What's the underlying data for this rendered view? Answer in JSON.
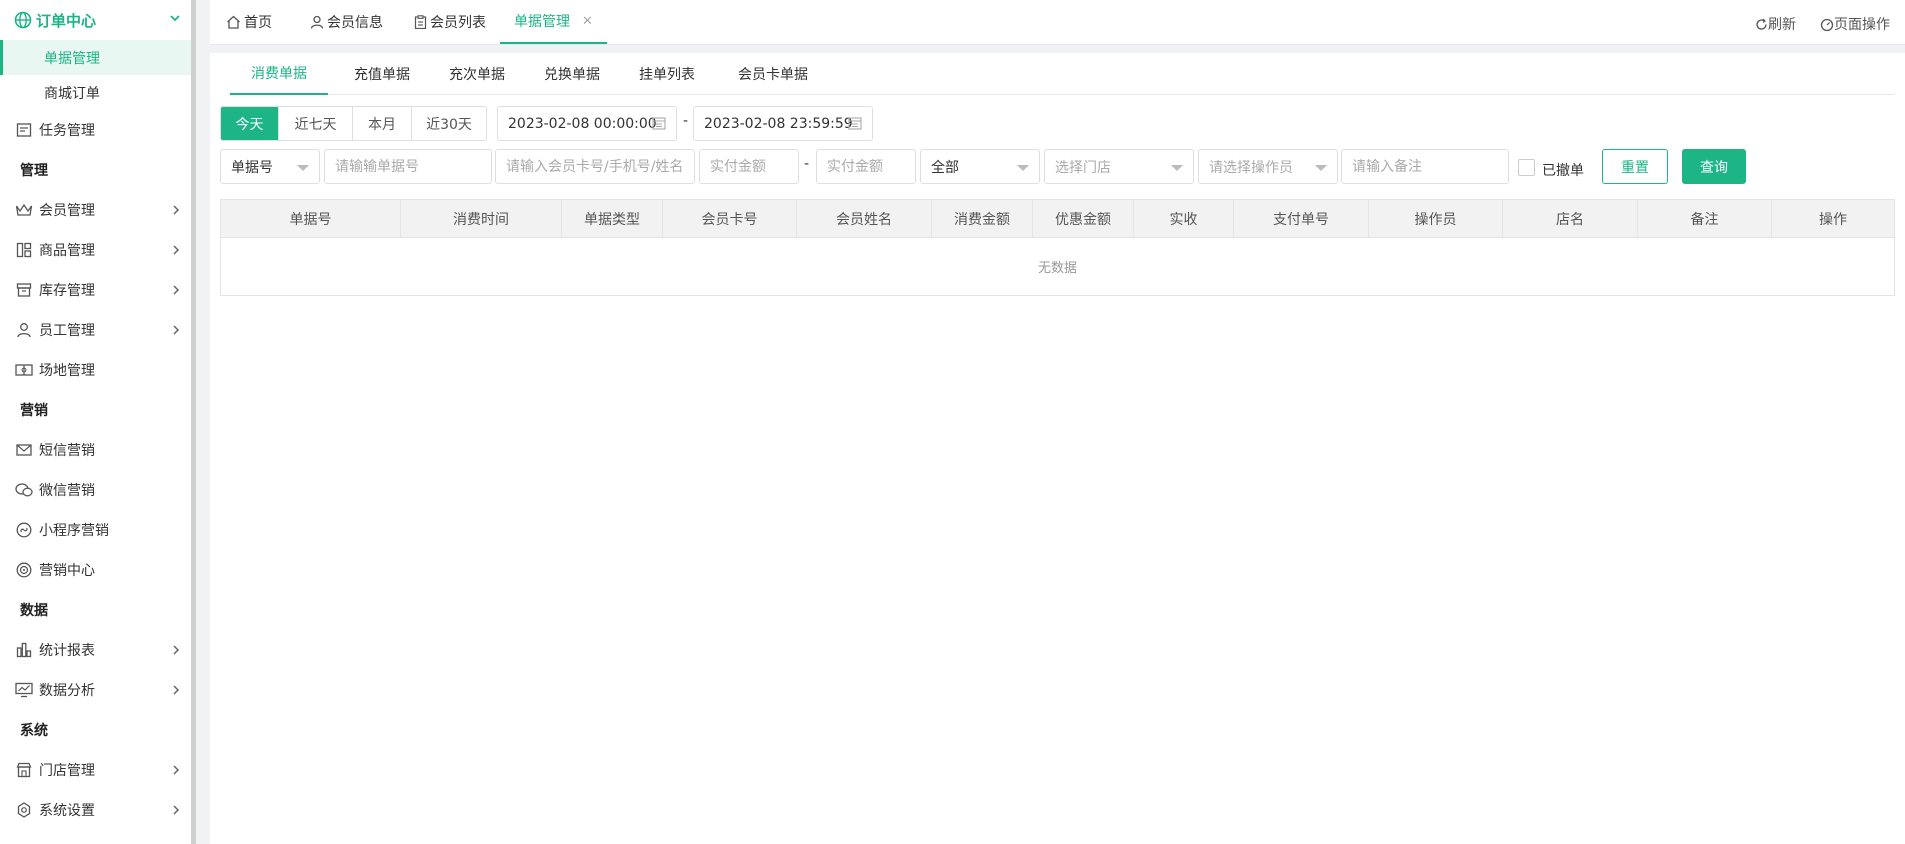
{
  "sidebar": {
    "open_group": "订单中心",
    "sub_items": [
      {
        "label": "单据管理",
        "active": true
      },
      {
        "label": "商城订单",
        "active": false
      }
    ],
    "task_item": "任务管理",
    "sections": [
      {
        "title": "管理",
        "items": [
          "会员管理",
          "商品管理",
          "库存管理",
          "员工管理",
          "场地管理"
        ]
      },
      {
        "title": "营销",
        "items": [
          "短信营销",
          "微信营销",
          "小程序营销",
          "营销中心"
        ]
      },
      {
        "title": "数据",
        "items": [
          "统计报表",
          "数据分析"
        ]
      },
      {
        "title": "系统",
        "items": [
          "门店管理",
          "系统设置"
        ]
      }
    ]
  },
  "top_tabs": [
    {
      "label": "首页",
      "icon": "home-icon"
    },
    {
      "label": "会员信息",
      "icon": "user-icon"
    },
    {
      "label": "会员列表",
      "icon": "clipboard-icon"
    },
    {
      "label": "单据管理",
      "icon": "",
      "active": true,
      "closable": true
    }
  ],
  "top_actions": {
    "refresh": "刷新",
    "page_ops": "页面操作"
  },
  "sub_tabs": [
    "消费单据",
    "充值单据",
    "充次单据",
    "兑换单据",
    "挂单列表",
    "会员卡单据"
  ],
  "date_range_buttons": [
    "今天",
    "近七天",
    "本月",
    "近30天"
  ],
  "date_start": "2023-02-08 00:00:00",
  "date_end": "2023-02-08 23:59:59",
  "date_separator": "-",
  "filters": {
    "order_type_select": "单据号",
    "order_no_placeholder": "请输输单据号",
    "member_placeholder": "请输入会员卡号/手机号/姓名",
    "amount_min_placeholder": "实付金额",
    "amount_separator": "-",
    "amount_max_placeholder": "实付金额",
    "status_select": "全部",
    "store_select": "选择门店",
    "operator_select": "请选择操作员",
    "remark_placeholder": "请输入备注",
    "revoked_label": "已撤单"
  },
  "buttons": {
    "reset": "重置",
    "query": "查询"
  },
  "table": {
    "columns": [
      "单据号",
      "消费时间",
      "单据类型",
      "会员卡号",
      "会员姓名",
      "消费金额",
      "优惠金额",
      "实收",
      "支付单号",
      "操作员",
      "店名",
      "备注",
      "操作"
    ],
    "empty_text": "无数据"
  },
  "colors": {
    "accent": "#1db486"
  }
}
